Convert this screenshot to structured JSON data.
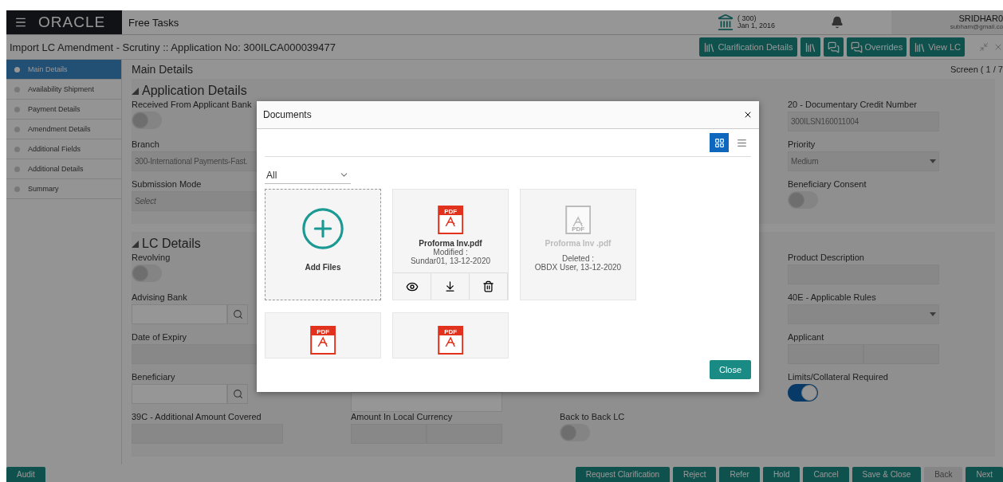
{
  "header": {
    "logo": "ORACLE",
    "menu_title": "Free Tasks",
    "branch_code": "( 300)",
    "branch_date": "Jan 1, 2016",
    "user_name": "SRIDHAR0",
    "user_email": "subham@gmail.co"
  },
  "subheader": {
    "title": "Import LC Amendment - Scrutiny :: Application No: 300ILCA000039477",
    "buttons": [
      {
        "kind": "books",
        "label": "Clarification Details"
      },
      {
        "kind": "books"
      },
      {
        "kind": "chat"
      },
      {
        "kind": "chat",
        "label": "Overrides"
      },
      {
        "kind": "books",
        "label": "View LC"
      }
    ]
  },
  "sidebar": {
    "items": [
      {
        "label": "Main Details",
        "selected": true
      },
      {
        "label": "Availability Shipment",
        "selected": false
      },
      {
        "label": "Payment Details",
        "selected": false
      },
      {
        "label": "Amendment Details",
        "selected": false
      },
      {
        "label": "Additional Fields",
        "selected": false
      },
      {
        "label": "Additional Details",
        "selected": false
      },
      {
        "label": "Summary",
        "selected": false
      }
    ]
  },
  "page": {
    "title": "Main Details",
    "screen_counter": "Screen ( 1 / 7",
    "sections": [
      {
        "title": "Application Details",
        "expanded": true,
        "rows": [
          [
            {
              "kind": "toggle",
              "label": "Received From Applicant Bank",
              "on": false
            },
            {
              "kind": "empty"
            },
            {
              "kind": "empty"
            },
            {
              "kind": "text",
              "label": "20 - Documentary Credit Number",
              "value": "300ILSN160011004"
            }
          ],
          [
            {
              "kind": "text",
              "label": "Branch",
              "value": "300-International Payments-Fast."
            },
            {
              "kind": "empty"
            },
            {
              "kind": "empty"
            },
            {
              "kind": "select",
              "label": "Priority",
              "value": "Medium"
            }
          ],
          [
            {
              "kind": "select",
              "label": "Submission Mode",
              "placeholder": "Select"
            },
            {
              "kind": "empty"
            },
            {
              "kind": "empty"
            },
            {
              "kind": "toggle",
              "label": "Beneficiary Consent",
              "on": false
            }
          ]
        ]
      },
      {
        "title": "LC Details",
        "expanded": true,
        "rows": [
          [
            {
              "kind": "toggle",
              "label": "Revolving",
              "on": false
            },
            {
              "kind": "empty"
            },
            {
              "kind": "empty"
            },
            {
              "kind": "text",
              "label": "Product Description"
            }
          ],
          [
            {
              "kind": "search",
              "label": "Advising Bank"
            },
            {
              "kind": "empty"
            },
            {
              "kind": "empty"
            },
            {
              "kind": "select",
              "label": "40E - Applicable Rules"
            }
          ],
          [
            {
              "kind": "text",
              "label": "Date of Expiry"
            },
            {
              "kind": "empty"
            },
            {
              "kind": "empty"
            },
            {
              "kind": "split",
              "label": "Applicant"
            }
          ],
          [
            {
              "kind": "search",
              "label": "Beneficiary"
            },
            {
              "kind": "blank"
            },
            {
              "kind": "empty"
            },
            {
              "kind": "toggle",
              "label": "Limits/Collateral Required",
              "on": true
            }
          ],
          [
            {
              "kind": "text",
              "label": "39C - Additional Amount Covered"
            },
            {
              "kind": "split",
              "label": "Amount In Local Currency"
            },
            {
              "kind": "toggle",
              "label": "Back to Back LC",
              "on": false
            },
            {
              "kind": "empty"
            }
          ]
        ]
      }
    ]
  },
  "footer": {
    "buttons": [
      {
        "label": "Audit",
        "disabled": false
      },
      {
        "label": "Request Clarification",
        "disabled": false
      },
      {
        "label": "Reject",
        "disabled": false
      },
      {
        "label": "Refer",
        "disabled": false
      },
      {
        "label": "Hold",
        "disabled": false
      },
      {
        "label": "Cancel",
        "disabled": false
      },
      {
        "label": "Save & Close",
        "disabled": false
      },
      {
        "label": "Back",
        "disabled": true
      },
      {
        "label": "Next",
        "disabled": false
      }
    ]
  },
  "dialog": {
    "title": "Documents",
    "views": [
      {
        "kind": "grid",
        "selected": true
      },
      {
        "kind": "list",
        "selected": false
      }
    ],
    "filter": "All",
    "close_label": "Close",
    "documents": [
      {
        "kind": "add",
        "label": "Add Files"
      },
      {
        "kind": "file",
        "badge": "PDF",
        "name": "Proforma Inv.pdf",
        "status": "Modified :",
        "meta": "Sundar01, 13-12-2020",
        "deleted": false,
        "hovered": true
      },
      {
        "kind": "file",
        "badge": "PDF",
        "name": "Proforma Inv .pdf",
        "status": "Deleted :",
        "meta": "OBDX User, 13-12-2020",
        "deleted": true,
        "hovered": false
      },
      {
        "kind": "file",
        "badge": "PDF",
        "deleted": false,
        "hovered": false
      },
      {
        "kind": "file",
        "badge": "PDF",
        "deleted": false,
        "hovered": false
      }
    ]
  }
}
